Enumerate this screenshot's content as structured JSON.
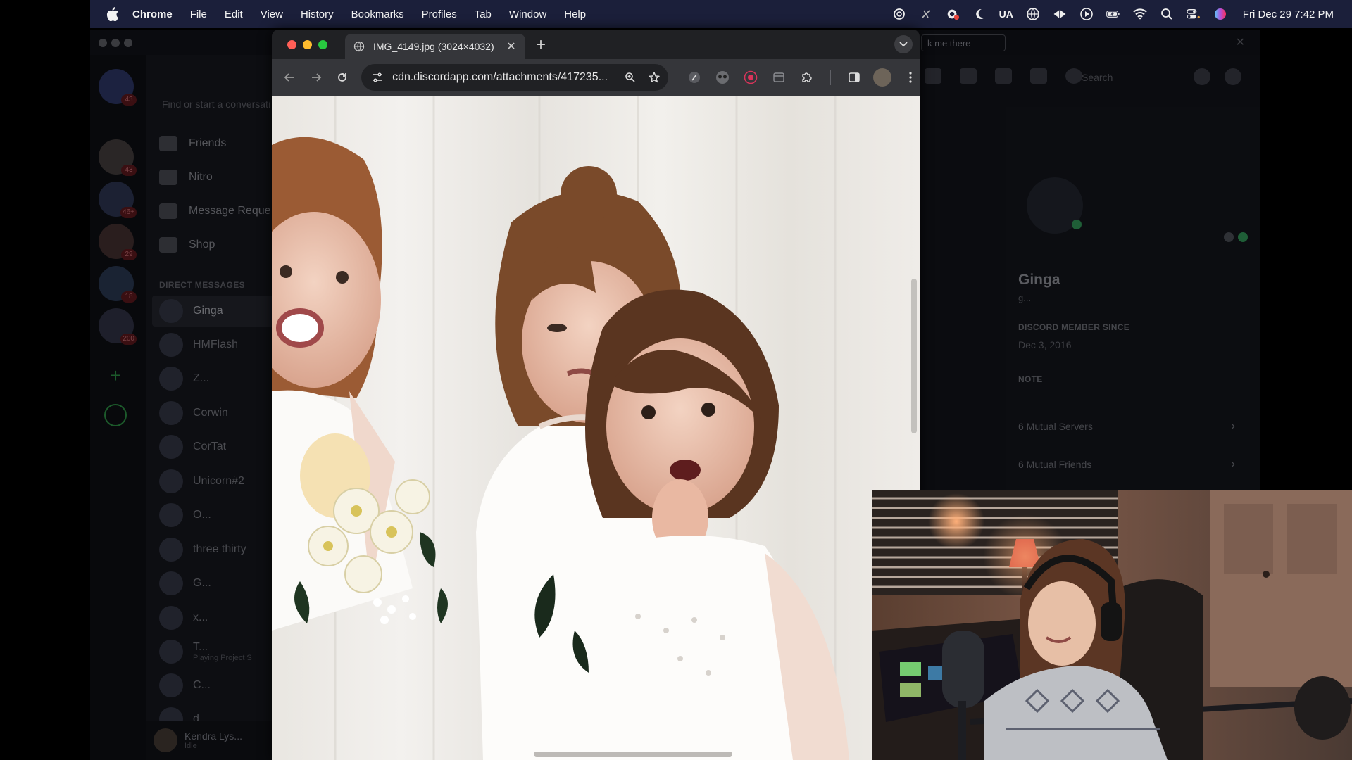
{
  "menubar": {
    "app_name": "Chrome",
    "menus": [
      "File",
      "Edit",
      "View",
      "History",
      "Bookmarks",
      "Profiles",
      "Tab",
      "Window",
      "Help"
    ],
    "input_source": "UA",
    "clock": "Fri Dec 29  7:42 PM",
    "tray_icons": [
      "openai-icon",
      "feather-off-icon",
      "cloud-alert-icon",
      "moon-icon",
      "input-source-icon",
      "globe-icon",
      "diamond-icon",
      "play-icon",
      "battery-charging-icon",
      "wifi-icon",
      "spotlight-search-icon",
      "control-center-icon",
      "siri-icon"
    ]
  },
  "discord": {
    "notice_button": "k me there",
    "search_placeholder": "Find or start a conversati",
    "nav": [
      "Friends",
      "Nitro",
      "Message Reque",
      "Shop"
    ],
    "dm_header": "DIRECT MESSAGES",
    "dms": [
      {
        "name": "Ginga",
        "active": true
      },
      {
        "name": "HMFlash"
      },
      {
        "name": "Z..."
      },
      {
        "name": "Corwin"
      },
      {
        "name": "CorTat"
      },
      {
        "name": "Unicorn#2"
      },
      {
        "name": "O..."
      },
      {
        "name": "three thirty"
      },
      {
        "name": "G..."
      },
      {
        "name": "x..."
      },
      {
        "name": "T...",
        "sub": "Playing Project S"
      },
      {
        "name": "C..."
      },
      {
        "name": "d..."
      }
    ],
    "server_badges": [
      "43",
      "43",
      "46+",
      "29",
      "18",
      "200"
    ],
    "user": {
      "name": "Kendra Lys...",
      "status": "Idle"
    },
    "chat_search": "Search",
    "profile": {
      "name": "Ginga",
      "tag": "g...",
      "member_since_label": "DISCORD MEMBER SINCE",
      "member_since": "Dec 3, 2016",
      "note_label": "NOTE",
      "mutual_servers": "6 Mutual Servers",
      "mutual_friends": "6 Mutual Friends"
    }
  },
  "chrome": {
    "tab_title": "IMG_4149.jpg (3024×4032)",
    "url": "cdn.discordapp.com/attachments/417235...",
    "colors": {
      "close": "#ff5f57",
      "minimize": "#febc2e",
      "zoom": "#28c840"
    }
  },
  "webcam": {
    "description_visible": false
  }
}
